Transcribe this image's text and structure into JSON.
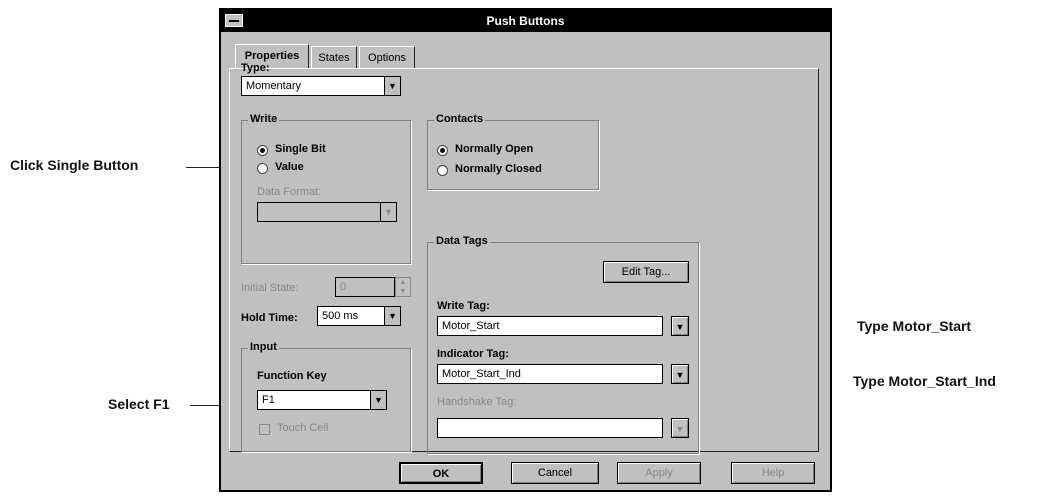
{
  "callouts": {
    "click_single": "Click Single Button",
    "select_f1": "Select F1",
    "type_motor_start": "Type Motor_Start",
    "type_motor_start_ind": "Type Motor_Start_Ind"
  },
  "window": {
    "title": "Push Buttons"
  },
  "tabs": [
    "Properties",
    "States",
    "Options"
  ],
  "type": {
    "label": "Type:",
    "value": "Momentary"
  },
  "write": {
    "title": "Write",
    "single_bit": "Single Bit",
    "value": "Value",
    "data_format_label": "Data Format:",
    "data_format_value": ""
  },
  "contacts": {
    "title": "Contacts",
    "normally_open": "Normally Open",
    "normally_closed": "Normally Closed"
  },
  "initial_state": {
    "label": "Initial State:",
    "value": "0"
  },
  "hold_time": {
    "label": "Hold Time:",
    "value": "500 ms"
  },
  "input": {
    "title": "Input",
    "function_key_label": "Function Key",
    "function_key_value": "F1",
    "touch_cell": "Touch Cell"
  },
  "data_tags": {
    "title": "Data Tags",
    "edit_tag_button": "Edit Tag...",
    "write_tag_label": "Write Tag:",
    "write_tag_value": "Motor_Start",
    "indicator_tag_label": "Indicator Tag:",
    "indicator_tag_value": "Motor_Start_Ind",
    "handshake_tag_label": "Handshake Tag:",
    "handshake_tag_value": ""
  },
  "buttons": {
    "ok": "OK",
    "cancel": "Cancel",
    "apply": "Apply",
    "help": "Help"
  }
}
